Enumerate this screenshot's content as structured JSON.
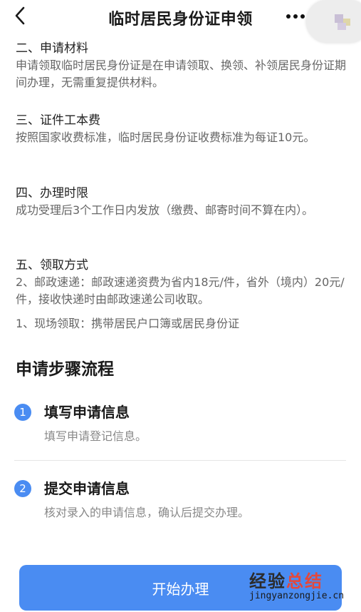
{
  "nav": {
    "title": "临时居民身份证申领",
    "back_icon": "chevron-left-icon",
    "more_icon": "more-dots-icon"
  },
  "sections": [
    {
      "heading": "二、申请材料",
      "body": [
        "申请领取临时居民身份证是在申请领取、换领、补领居民身份证期间办理，无需重复提供材料。"
      ]
    },
    {
      "heading": "三、证件工本费",
      "body": [
        "按照国家收费标准，临时居民身份证收费标准为每证10元。"
      ]
    },
    {
      "heading": "四、办理时限",
      "body": [
        "成功受理后3个工作日内发放（缴费、邮寄时间不算在内）。"
      ]
    },
    {
      "heading": "五、领取方式",
      "body": [
        "2、邮政速递：邮政速递资费为省内18元/件，省外（境内）20元/件，接收快递时由邮政速递公司收取。",
        "1、现场领取：携带居民户口簿或居民身份证"
      ]
    }
  ],
  "steps_section": {
    "title": "申请步骤流程",
    "steps": [
      {
        "number": "1",
        "title": "填写申请信息",
        "description": "填写申请登记信息。"
      },
      {
        "number": "2",
        "title": "提交申请信息",
        "description": "核对录入的申请信息，确认后提交办理。"
      }
    ]
  },
  "start_button": {
    "label": "开始办理"
  },
  "watermark": {
    "line1_a": "经验",
    "line1_b": "总结",
    "line2": "jingyanzongjie.cn"
  },
  "colors": {
    "accent": "#4a8cf2",
    "background": "#ffffff"
  }
}
